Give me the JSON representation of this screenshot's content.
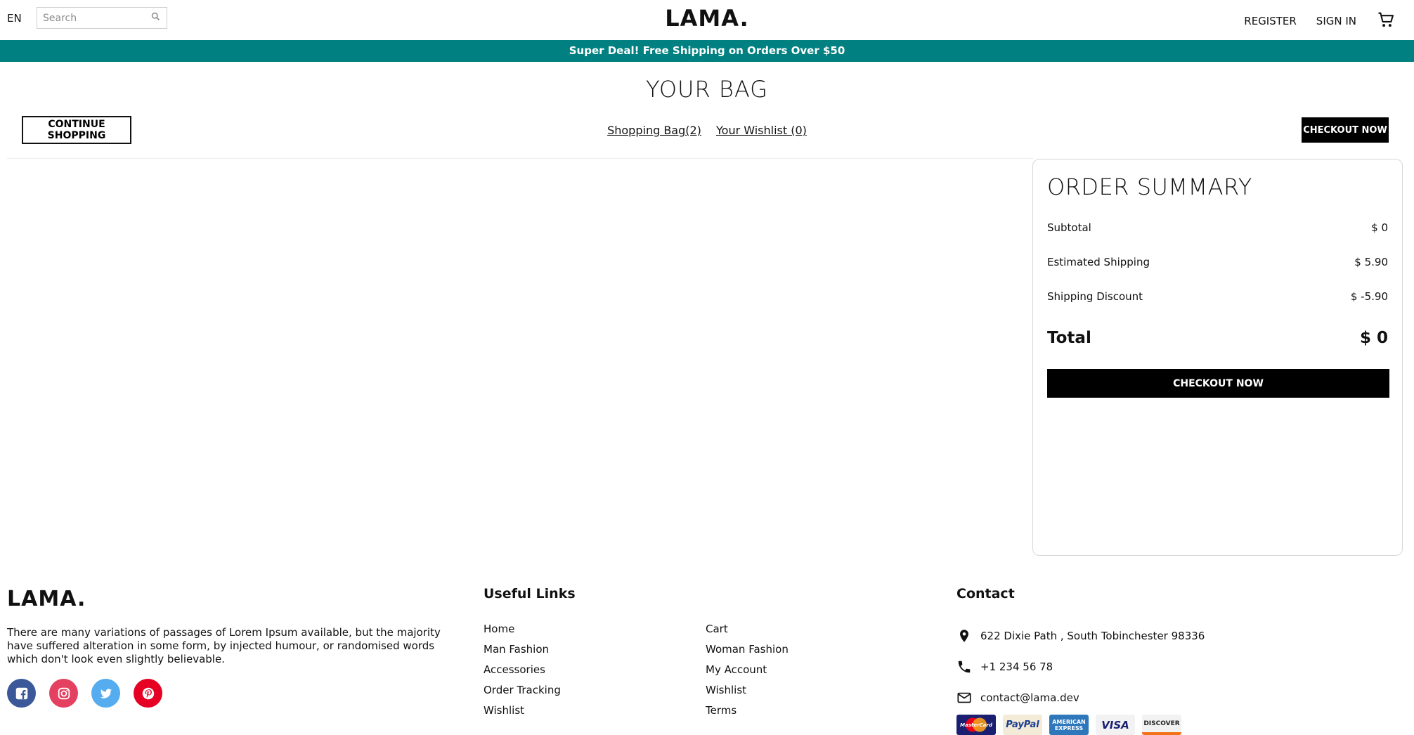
{
  "navbar": {
    "language": "EN",
    "search_placeholder": "Search",
    "logo": "LAMA.",
    "register": "REGISTER",
    "signin": "SIGN IN"
  },
  "announcement": "Super Deal! Free Shipping on Orders Over $50",
  "cart_page": {
    "title": "YOUR BAG",
    "continue_label": "CONTINUE SHOPPING",
    "shopping_bag_link": "Shopping Bag(2)",
    "wishlist_link": "Your Wishlist (0)",
    "checkout_top_label": "CHECKOUT NOW"
  },
  "summary": {
    "title": "ORDER SUMMARY",
    "rows": [
      {
        "label": "Subtotal",
        "value": "$ 0"
      },
      {
        "label": "Estimated Shipping",
        "value": "$ 5.90"
      },
      {
        "label": "Shipping Discount",
        "value": "$ -5.90"
      }
    ],
    "total_label": "Total",
    "total_value": "$ 0",
    "checkout_label": "CHECKOUT NOW"
  },
  "footer": {
    "logo": "LAMA.",
    "description": "There are many variations of passages of Lorem Ipsum available, but the majority have suffered alteration in some form, by injected humour, or randomised words which don't look even slightly believable.",
    "social_icons": [
      "facebook-icon",
      "instagram-icon",
      "twitter-icon",
      "pinterest-icon"
    ],
    "social_colors": [
      "#3b5999",
      "#e4405f",
      "#55acee",
      "#e60023"
    ],
    "links_title": "Useful Links",
    "links_left": [
      "Home",
      "Man Fashion",
      "Accessories",
      "Order Tracking",
      "Wishlist"
    ],
    "links_right": [
      "Cart",
      "Woman Fashion",
      "My Account",
      "Wishlist",
      "Terms"
    ],
    "contact_title": "Contact",
    "contact": {
      "address": "622 Dixie Path , South Tobinchester 98336",
      "phone": "+1 234 56 78",
      "email": "contact@lama.dev"
    },
    "payments": [
      "MasterCard",
      "PayPal",
      "AMERICAN EXPRESS",
      "VISA",
      "DISCOVER"
    ]
  },
  "colors": {
    "announcement_bg": "#008080",
    "button_dark": "#000000"
  }
}
